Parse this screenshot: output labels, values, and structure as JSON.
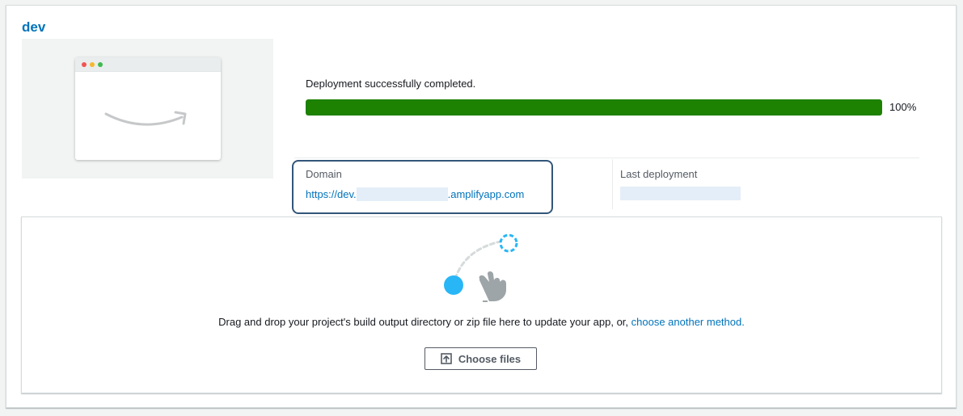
{
  "branch": {
    "name": "dev"
  },
  "deployment": {
    "status_text": "Deployment successfully completed.",
    "progress_percent": 100,
    "progress_label": "100%",
    "progress_color": "#1d8102"
  },
  "domain": {
    "label": "Domain",
    "url_prefix": "https://dev.",
    "url_suffix": ".amplifyapp.com"
  },
  "last_deployment": {
    "label": "Last deployment"
  },
  "dropzone": {
    "text": "Drag and drop your project's build output directory or zip file here to update your app, or, ",
    "link_text": "choose another method.",
    "button_label": "Choose files",
    "button_icon": "upload-icon"
  },
  "colors": {
    "link": "#0073bb",
    "highlight_border": "#33567a",
    "accent_blue": "#29b6f6"
  }
}
